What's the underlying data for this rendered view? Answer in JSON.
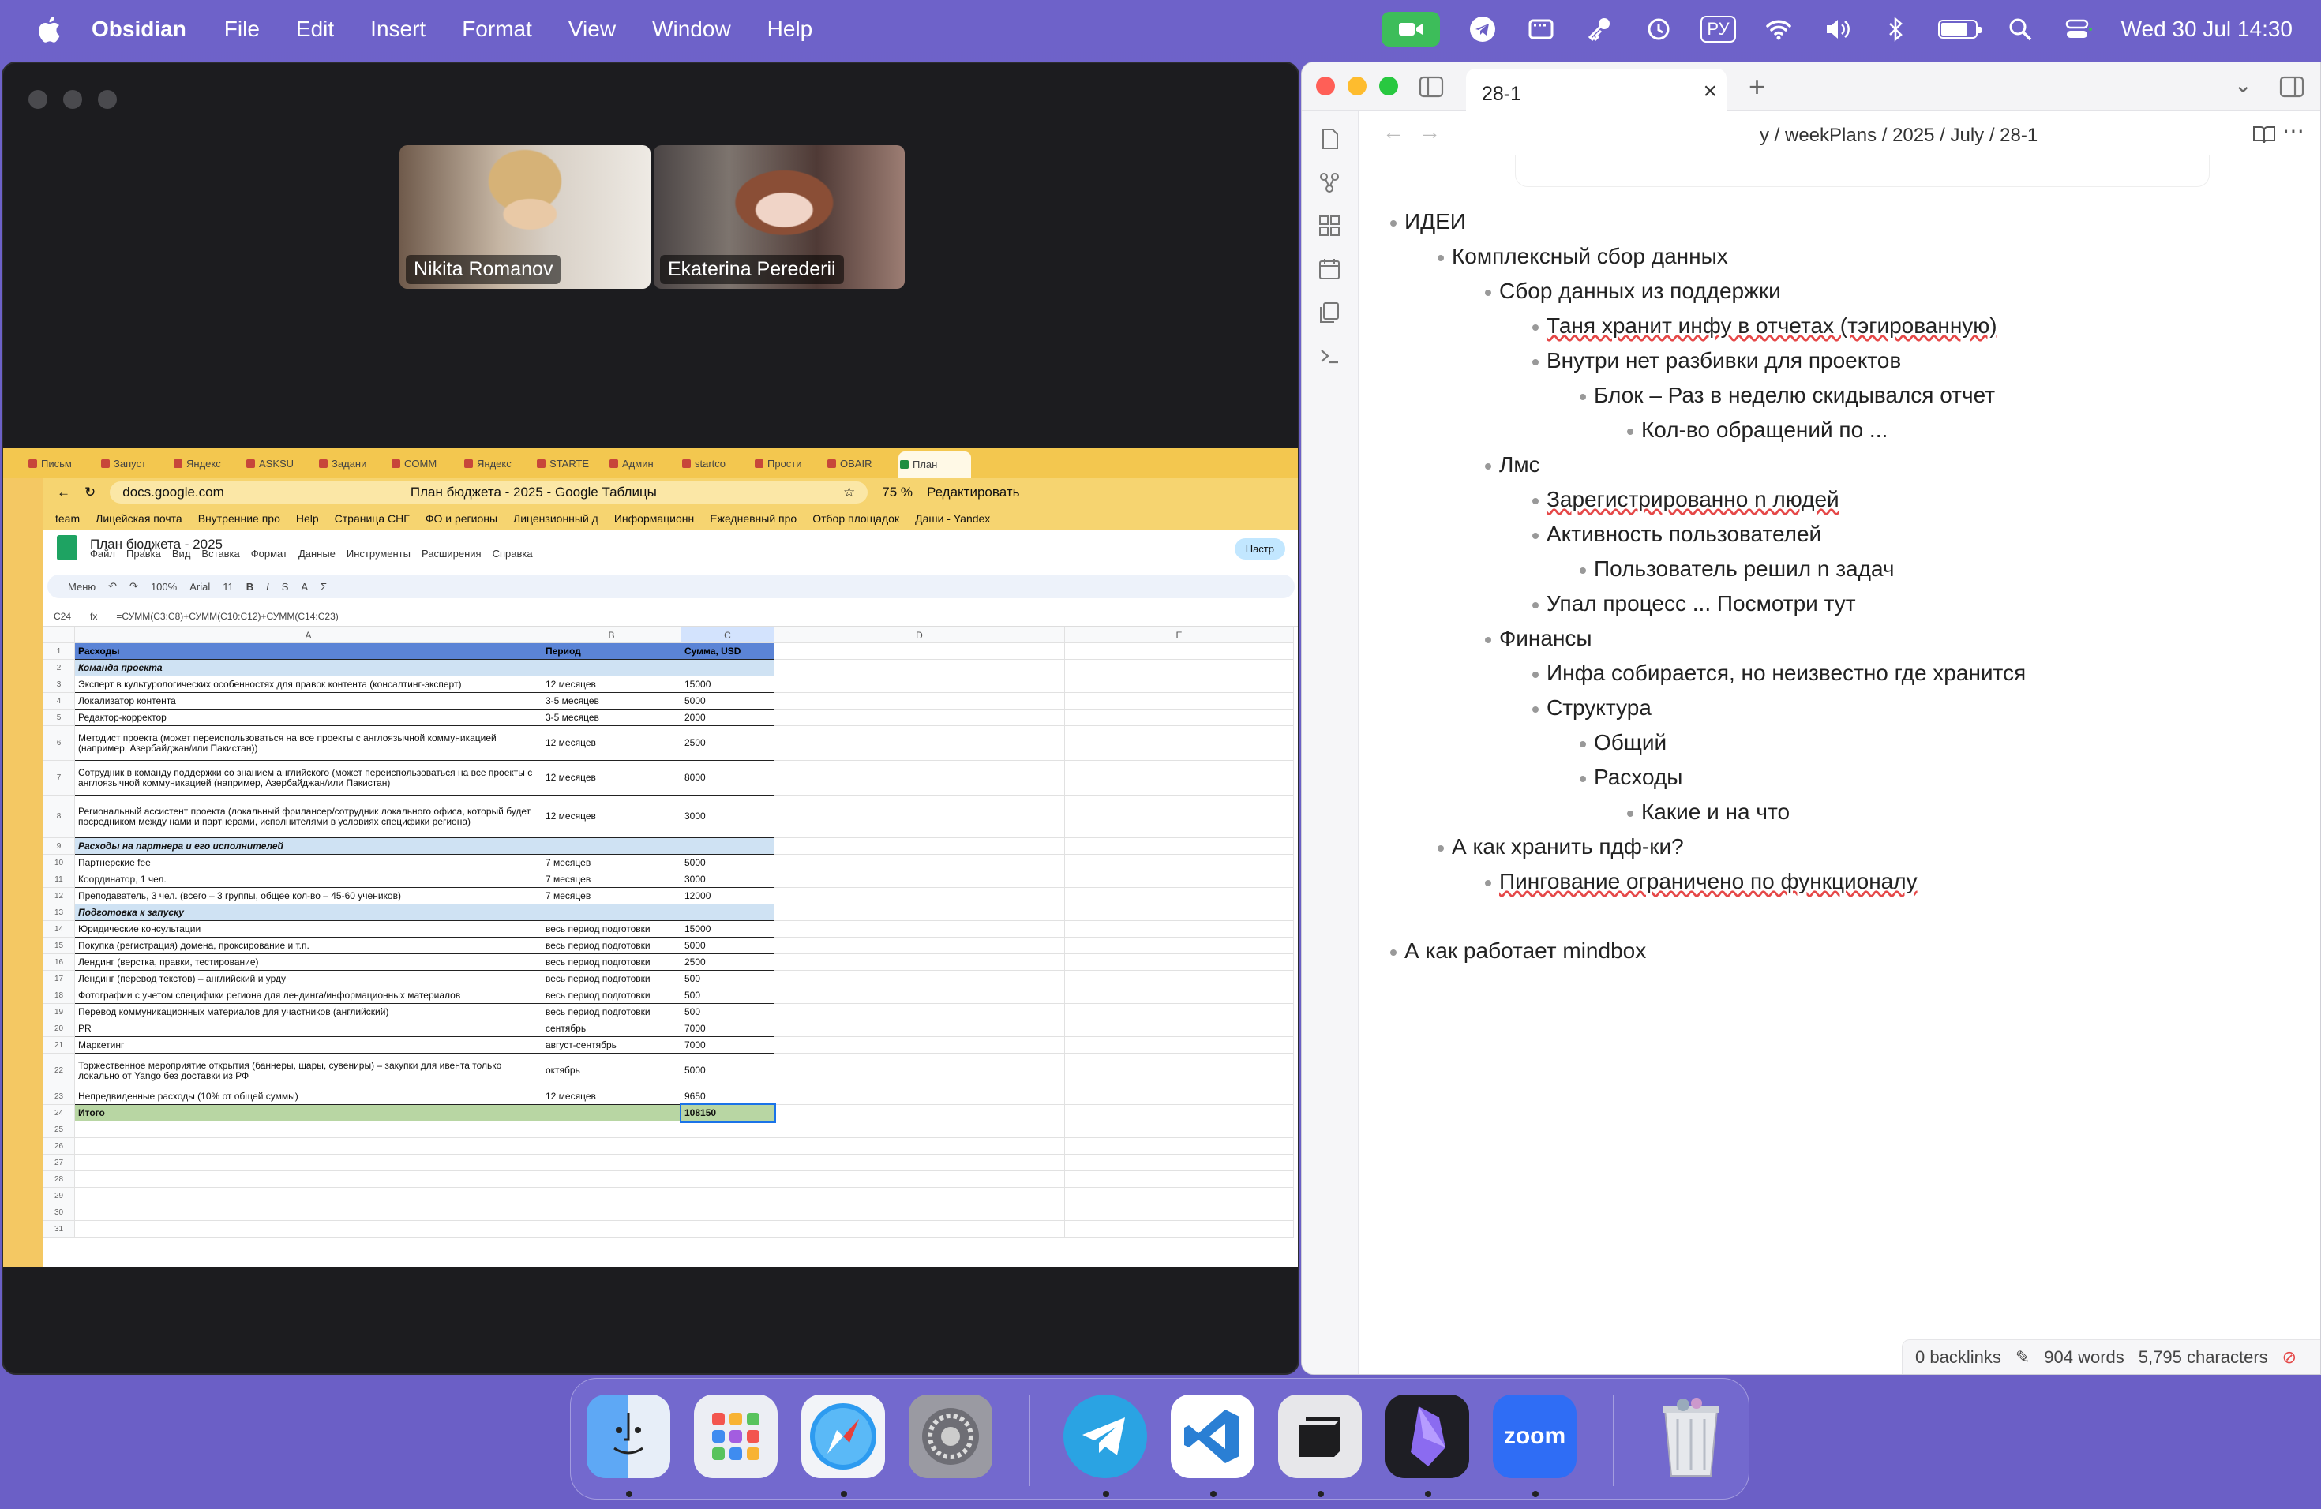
{
  "menubar": {
    "app_name": "Obsidian",
    "items": [
      "File",
      "Edit",
      "Insert",
      "Format",
      "View",
      "Window",
      "Help"
    ],
    "keyboard_layout": "РУ",
    "clock": "Wed 30 Jul  14:30"
  },
  "zoom": {
    "participants": [
      "Nikita Romanov",
      "Ekaterina Perederii"
    ]
  },
  "browser": {
    "tabs": [
      "Письм",
      "Запуст",
      "Яндекс",
      "ASKSU",
      "Задани",
      "COMM",
      "Яндекс",
      "STARTE",
      "Админ",
      "startco",
      "Прости",
      "OBAIR",
      "План"
    ],
    "url": "docs.google.com",
    "page_title": "План бюджета - 2025 - Google Таблицы",
    "zoom_label": "75 %",
    "edit_label": "Редактировать",
    "bookmarks": [
      "team",
      "Лицейская почта",
      "Внутренние про",
      "Help",
      "Страница СНГ",
      "ФО и регионы",
      "Лицензионный д",
      "Информационн",
      "Ежедневный про",
      "Отбор площадок",
      "Даши - Yandex"
    ]
  },
  "sheet": {
    "title": "План бюджета - 2025",
    "menu": [
      "Файл",
      "Правка",
      "Вид",
      "Вставка",
      "Формат",
      "Данные",
      "Инструменты",
      "Расширения",
      "Справка"
    ],
    "share_label": "Настр",
    "toolbar": {
      "menu": "Меню",
      "zoom": "100%",
      "font": "Arial",
      "size": "11"
    },
    "cell_ref": "C24",
    "formula": "=СУММ(C3:C8)+СУММ(C10:C12)+СУММ(C14:C23)",
    "col_headers": [
      "A",
      "B",
      "C",
      "D",
      "E"
    ],
    "rows": [
      {
        "n": "1",
        "a": "Расходы",
        "b": "Период",
        "c": "Сумма, USD",
        "kind": "header"
      },
      {
        "n": "2",
        "a": "Команда проекта",
        "b": "",
        "c": "",
        "kind": "section"
      },
      {
        "n": "3",
        "a": "Эксперт в культурологических особенностях для правок контента (консалтинг-эксперт)",
        "b": "12 месяцев",
        "c": "15000",
        "kind": "row"
      },
      {
        "n": "4",
        "a": "Локализатор контента",
        "b": "3-5 месяцев",
        "c": "5000",
        "kind": "row"
      },
      {
        "n": "5",
        "a": "Редактор-корректор",
        "b": "3-5 месяцев",
        "c": "2000",
        "kind": "row"
      },
      {
        "n": "6",
        "a": "Методист проекта (может переиспользоваться на все проекты с англоязычной коммуникацией (например, Азербайджан/или Пакистан))",
        "b": "12 месяцев",
        "c": "2500",
        "kind": "tall"
      },
      {
        "n": "7",
        "a": "Сотрудник в команду поддержки со знанием английского (может переиспользоваться на все проекты с англоязычной коммуникацией (например, Азербайджан/или Пакистан)",
        "b": "12 месяцев",
        "c": "8000",
        "kind": "tall"
      },
      {
        "n": "8",
        "a": "Региональный ассистент проекта (локальный фрилансер/сотрудник локального офиса, который будет посредником между нами и партнерами, исполнителями в условиях специфики региона)",
        "b": "12 месяцев",
        "c": "3000",
        "kind": "tall3"
      },
      {
        "n": "9",
        "a": "Расходы на партнера и его исполнителей",
        "b": "",
        "c": "",
        "kind": "section"
      },
      {
        "n": "10",
        "a": "Партнерские fee",
        "b": "7 месяцев",
        "c": "5000",
        "kind": "row"
      },
      {
        "n": "11",
        "a": "Координатор, 1 чел.",
        "b": "7 месяцев",
        "c": "3000",
        "kind": "row"
      },
      {
        "n": "12",
        "a": "Преподаватель, 3 чел. (всего – 3 группы, общее кол-во – 45-60 учеников)",
        "b": "7 месяцев",
        "c": "12000",
        "kind": "row"
      },
      {
        "n": "13",
        "a": "Подготовка к запуску",
        "b": "",
        "c": "",
        "kind": "section"
      },
      {
        "n": "14",
        "a": "Юридические консультации",
        "b": "весь период подготовки",
        "c": "15000",
        "kind": "row"
      },
      {
        "n": "15",
        "a": "Покупка (регистрация) домена, проксирование и т.п.",
        "b": "весь период подготовки",
        "c": "5000",
        "kind": "row"
      },
      {
        "n": "16",
        "a": "Лендинг (верстка, правки, тестирование)",
        "b": "весь период подготовки",
        "c": "2500",
        "kind": "row"
      },
      {
        "n": "17",
        "a": "Лендинг (перевод текстов) – английский и урду",
        "b": "весь период подготовки",
        "c": "500",
        "kind": "row"
      },
      {
        "n": "18",
        "a": "Фотографии с учетом специфики региона для лендинга/информационных материалов",
        "b": "весь период подготовки",
        "c": "500",
        "kind": "row"
      },
      {
        "n": "19",
        "a": "Перевод коммуникационных материалов для участников (английский)",
        "b": "весь период подготовки",
        "c": "500",
        "kind": "row"
      },
      {
        "n": "20",
        "a": "PR",
        "b": "сентябрь",
        "c": "7000",
        "kind": "row"
      },
      {
        "n": "21",
        "a": "Маркетинг",
        "b": "август-сентябрь",
        "c": "7000",
        "kind": "row"
      },
      {
        "n": "22",
        "a": "Торжественное мероприятие открытия (баннеры, шары, сувениры) – закупки для ивента только локально от Yango без доставки из РФ",
        "b": "октябрь",
        "c": "5000",
        "kind": "tall"
      },
      {
        "n": "23",
        "a": "Непредвиденные расходы (10% от общей суммы)",
        "b": "12 месяцев",
        "c": "9650",
        "kind": "row"
      },
      {
        "n": "24",
        "a": "Итого",
        "b": "",
        "c": "108150",
        "kind": "total"
      },
      {
        "n": "25",
        "a": "",
        "b": "",
        "c": "",
        "kind": "empty"
      },
      {
        "n": "26",
        "a": "",
        "b": "",
        "c": "",
        "kind": "empty"
      },
      {
        "n": "27",
        "a": "",
        "b": "",
        "c": "",
        "kind": "empty"
      },
      {
        "n": "28",
        "a": "",
        "b": "",
        "c": "",
        "kind": "empty"
      },
      {
        "n": "29",
        "a": "",
        "b": "",
        "c": "",
        "kind": "empty"
      },
      {
        "n": "30",
        "a": "",
        "b": "",
        "c": "",
        "kind": "empty"
      },
      {
        "n": "31",
        "a": "",
        "b": "",
        "c": "",
        "kind": "empty"
      }
    ]
  },
  "obsidian": {
    "tab_title": "28-1",
    "breadcrumb": "y  /  weekPlans  /  2025  /  July  /  28-1",
    "outline": [
      {
        "level": 0,
        "text": "ИДЕИ"
      },
      {
        "level": 1,
        "text": "Комплексный сбор данных"
      },
      {
        "level": 2,
        "text": "Сбор данных из поддержки"
      },
      {
        "level": 3,
        "text": "Таня хранит инфу в отчетах (тэгированную)"
      },
      {
        "level": 3,
        "text": "Внутри нет разбивки для проектов"
      },
      {
        "level": 4,
        "text": "Блок – Раз в неделю скидывался отчет"
      },
      {
        "level": 5,
        "text": "Кол-во обращений по ..."
      },
      {
        "level": 2,
        "text": "Лмс"
      },
      {
        "level": 3,
        "text": "Зарегистрированно n людей"
      },
      {
        "level": 3,
        "text": "Активность пользователей"
      },
      {
        "level": 4,
        "text": "Пользователь решил n задач"
      },
      {
        "level": 3,
        "text": "Упал процесс ... Посмотри тут"
      },
      {
        "level": 2,
        "text": "Финансы"
      },
      {
        "level": 3,
        "text": "Инфа собирается, но неизвестно где хранится"
      },
      {
        "level": 3,
        "text": "Структура"
      },
      {
        "level": 4,
        "text": "Общий"
      },
      {
        "level": 4,
        "text": "Расходы"
      },
      {
        "level": 5,
        "text": "Какие и на что"
      },
      {
        "level": 1,
        "text": "А как хранить пдф-ки?"
      },
      {
        "level": 2,
        "text": "Пингование ограничено по функционалу"
      },
      {
        "level": 0,
        "text": ""
      },
      {
        "level": 0,
        "text": "А как работает mindbox"
      }
    ],
    "status": {
      "backlinks": "0 backlinks",
      "words": "904 words",
      "characters": "5,795 characters"
    }
  },
  "dock": {
    "apps": [
      "finder-icon",
      "launchpad-icon",
      "safari-icon",
      "system-settings-icon",
      "telegram-icon",
      "vscode-icon",
      "dropzone-icon",
      "obsidian-icon",
      "zoom-icon",
      "trash-icon"
    ],
    "zoom_label": "zoom"
  },
  "colors": {
    "menubar_accent": "#3dbd5a",
    "sheet_header": "#5b84d6",
    "sheet_section": "#cfe2f3",
    "sheet_total": "#b8d6a3",
    "zoom_blue": "#2f6df5"
  }
}
